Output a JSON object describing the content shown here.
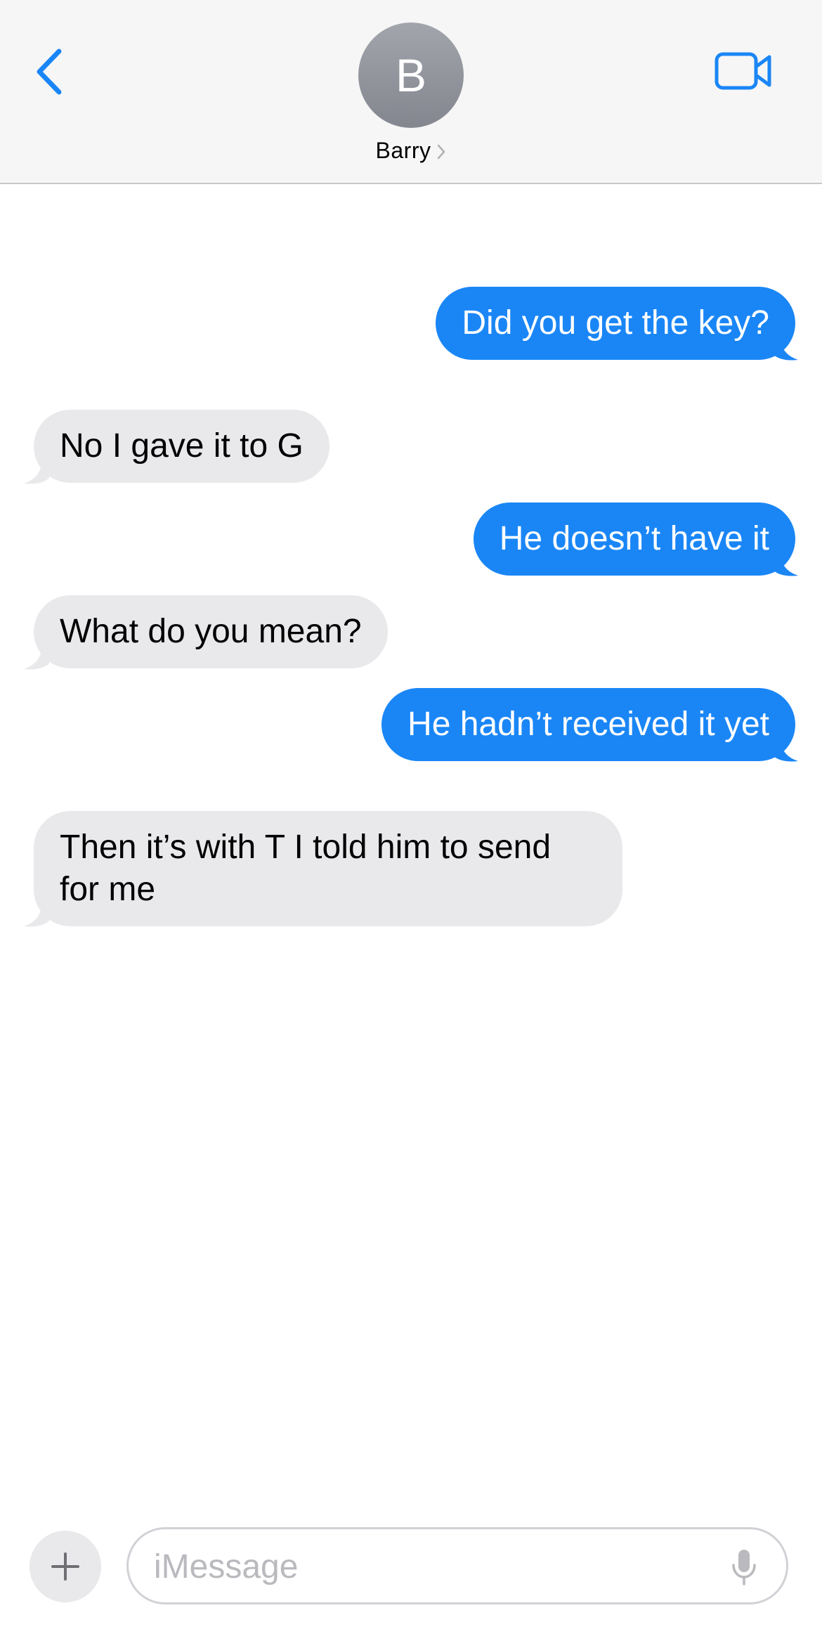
{
  "header": {
    "avatar_initial": "B",
    "contact_name": "Barry",
    "back_icon": "chevron-left-icon",
    "video_icon": "video-camera-icon",
    "accent_color": "#1a86f6"
  },
  "messages": [
    {
      "direction": "sent",
      "text": "Did you get the key?"
    },
    {
      "direction": "received",
      "text": "No I gave it to G"
    },
    {
      "direction": "sent",
      "text": "He doesn’t have it"
    },
    {
      "direction": "received",
      "text": "What do you mean?"
    },
    {
      "direction": "sent",
      "text": "He hadn’t received it yet"
    },
    {
      "direction": "received",
      "text": "Then it’s with T I told him to send for me"
    }
  ],
  "composer": {
    "placeholder": "iMessage",
    "value": "",
    "plus_icon": "plus-icon",
    "mic_icon": "microphone-icon"
  },
  "colors": {
    "sent_bubble": "#1a86f6",
    "received_bubble": "#e9e9eb",
    "header_background": "#f6f6f6"
  }
}
